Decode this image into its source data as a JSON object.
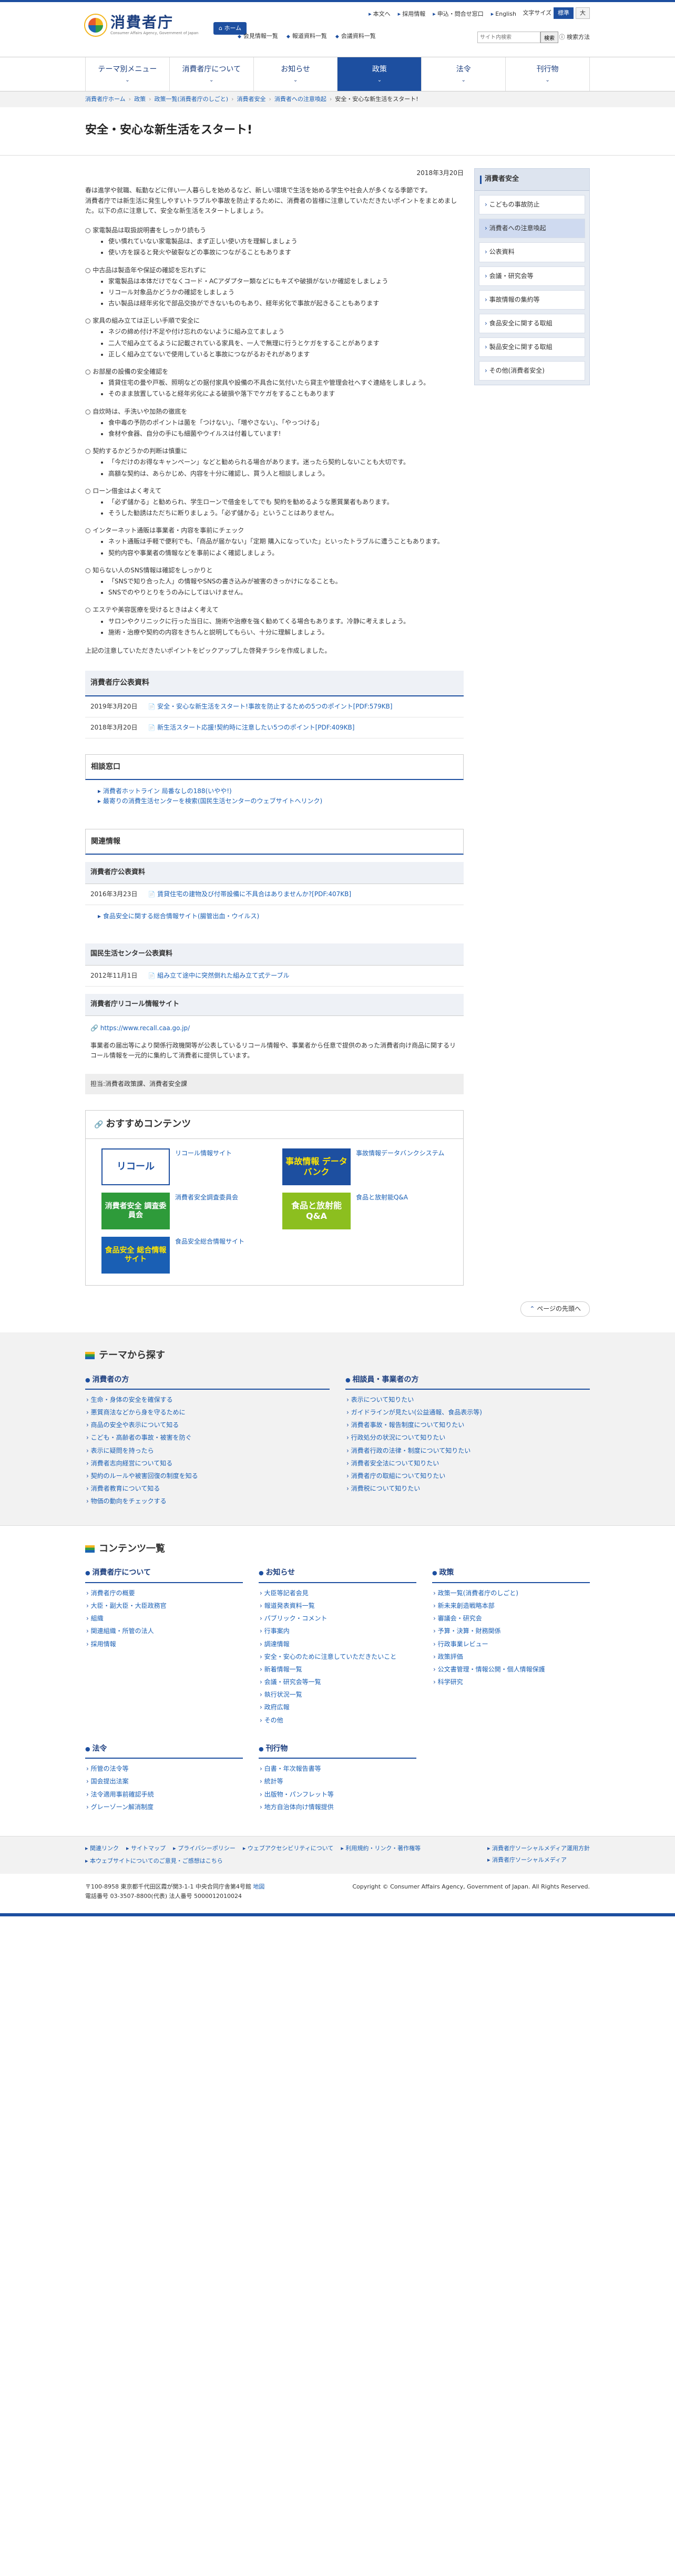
{
  "header": {
    "logo_text": "消費者庁",
    "logo_sub": "Consumer Affairs Agency, Government of Japan",
    "home_label": "ホーム",
    "util_links": [
      "本文へ",
      "採用情報",
      "申込・問合せ窓口",
      "English"
    ],
    "text_size_label": "文字サイズ",
    "text_size_options": [
      "標準",
      "大"
    ],
    "quick_links": [
      "会見情報一覧",
      "報道資料一覧",
      "会議資料一覧"
    ],
    "search_placeholder": "サイト内検索",
    "search_button": "検索",
    "search_detail": "検索方法"
  },
  "gnav": {
    "items": [
      "テーマ別メニュー",
      "消費者庁について",
      "お知らせ",
      "政策",
      "法令",
      "刊行物"
    ],
    "active_index": 3
  },
  "breadcrumb": [
    "消費者庁ホーム",
    "政策",
    "政策一覧(消費者庁のしごと)",
    "消費者安全",
    "消費者への注意喚起",
    "安全・安心な新生活をスタート!"
  ],
  "page": {
    "title": "安全・安心な新生活をスタート!",
    "date": "2018年3月20日",
    "intro": [
      "春は進学や就職、転勤などに伴い一人暮らしを始めるなど、新しい環境で生活を始める学生や社会人が多くなる季節です。",
      "消費者庁では新生活に発生しやすいトラブルや事故を防止するために、消費者の皆様に注意していただきたいポイントをまとめました。以下の点に注意して、安全な新生活をスタートしましょう。"
    ],
    "tips": [
      {
        "title": "家電製品は取扱説明書をしっかり読もう",
        "items": [
          "使い慣れていない家電製品は、まず正しい使い方を理解しましょう",
          "使い方を誤ると発火や破裂などの事故につながることもあります"
        ]
      },
      {
        "title": "中古品は製造年や保証の確認を忘れずに",
        "items": [
          "家電製品は本体だけでなくコード・ACアダプター類などにもキズや破損がないか確認をしましょう",
          "リコール対象品かどうかの確認をしましょう",
          "古い製品は経年劣化で部品交換ができないものもあり、経年劣化で事故が起きることもあります"
        ]
      },
      {
        "title": "家具の組み立ては正しい手順で安全に",
        "items": [
          "ネジの締め付け不足や付け忘れのないように組み立てましょう",
          "二人で組み立てるように記載されている家具を、一人で無理に行うとケガをすることがあります",
          "正しく組み立てないで使用していると事故につながるおそれがあります"
        ]
      },
      {
        "title": "お部屋の設備の安全確認を",
        "items": [
          "賃貸住宅の畳や戸板、照明などの据付家具や設備の不具合に気付いたら貸主や管理会社へすぐ連絡をしましょう。",
          "そのまま放置していると経年劣化による破損や落下でケガをすることもあります"
        ]
      },
      {
        "title": "自炊時は、手洗いや加熱の徹底を",
        "items": [
          "食中毒の予防のポイントは菌を「つけない」、「増やさない」、「やっつける」",
          "食材や食器、自分の手にも細菌やウイルスは付着しています!"
        ]
      },
      {
        "title": "契約するかどうかの判断は慎重に",
        "items": [
          "「今だけのお得なキャンペーン」などと勧められる場合があります。迷ったら契約しないことも大切です。",
          "高額な契約は、あらかじめ、内容を十分に確認し、買う人と相談しましょう。"
        ]
      },
      {
        "title": "ローン借金はよく考えて",
        "items": [
          "「必ず儲かる」と勧められ、学生ローンで借金をしてでも 契約を勧めるような悪質業者もあります。",
          "そうした勧誘はただちに断りましょう。「必ず儲かる」ということはありません。"
        ]
      },
      {
        "title": "インターネット通販は事業者・内容を事前にチェック",
        "items": [
          "ネット通販は手軽で便利でも、「商品が届かない」「定期 購入になっていた」といったトラブルに遭うこともあります。",
          "契約内容や事業者の情報などを事前によく確認しましょう。"
        ]
      },
      {
        "title": "知らない人のSNS情報は確認をしっかりと",
        "items": [
          "「SNSで知り合った人」の情報やSNSの書き込みが被害のきっかけになることも。",
          "SNSでのやりとりをうのみにしてはいけません。"
        ]
      },
      {
        "title": "エステや美容医療を受けるときはよく考えて",
        "items": [
          "サロンやクリニックに行った当日に、施術や治療を強く勧めてくる場合もあります。冷静に考えましょう。",
          "施術・治療や契約の内容をきちんと説明してもらい、十分に理解しましょう。"
        ]
      }
    ],
    "outro": "上記の注意していただきたいポイントをピックアップした啓発チラシを作成しました。"
  },
  "sections": {
    "caa_docs_title": "消費者庁公表資料",
    "caa_docs": [
      {
        "date": "2019年3月20日",
        "title": "安全・安心な新生活をスタート!事故を防止するための5つのポイント[PDF:579KB]"
      },
      {
        "date": "2018年3月20日",
        "title": "新生活スタート応援!契約時に注意したい5つのポイント[PDF:409KB]"
      }
    ],
    "consult_title": "相談窓口",
    "consult_links": [
      "消費者ホットライン 局番なしの188(いやや!)",
      "最寄りの消費生活センターを検索(国民生活センターのウェブサイトへリンク)"
    ],
    "related_title": "関連情報",
    "related_caa_title": "消費者庁公表資料",
    "related_caa_docs": [
      {
        "date": "2016年3月23日",
        "title": "賃貸住宅の建物及び付帯設備に不具合はありませんか?[PDF:407KB]"
      }
    ],
    "related_links": [
      "食品安全に関する総合情報サイト(腸管出血・ウイルス)"
    ],
    "ncac_title": "国民生活センター公表資料",
    "ncac_docs": [
      {
        "date": "2012年11月1日",
        "title": "組み立て途中に突然倒れた組み立て式テーブル"
      }
    ],
    "recall_title": "消費者庁リコール情報サイト",
    "recall_url": "https://www.recall.caa.go.jp/",
    "recall_desc": "事業者の届出等により関係行政機関等が公表しているリコール情報や、事業者から任意で提供のあった消費者向け商品に関するリコール情報を一元的に集約して消費者に提供しています。",
    "owner": "担当:消費者政策課、消費者安全課"
  },
  "recommend": {
    "title": "おすすめコンテンツ",
    "items": [
      {
        "banner": "リコール",
        "label": "リコール情報サイト"
      },
      {
        "banner": "事故情報 データバンク",
        "label": "事故情報データバンクシステム"
      },
      {
        "banner": "消費者安全 調査委員会",
        "label": "消費者安全調査委員会"
      },
      {
        "banner": "食品と放射能 Q&A",
        "label": "食品と放射能Q&A"
      },
      {
        "banner": "食品安全 総合情報サイト",
        "label": "食品安全総合情報サイト"
      }
    ]
  },
  "side": {
    "title": "消費者安全",
    "items": [
      "こどもの事故防止",
      "消費者への注意喚起",
      "公表資料",
      "会議・研究会等",
      "事故情報の集約等",
      "食品安全に関する取組",
      "製品安全に関する取組",
      "その他(消費者安全)"
    ],
    "current_index": 1
  },
  "pagetop": "ページの先頭へ",
  "themes": {
    "title": "テーマから探す",
    "cols": [
      {
        "head": "消費者の方",
        "items": [
          "生命・身体の安全を確保する",
          "悪質商法などから身を守るために",
          "商品の安全や表示について知る",
          "こども・高齢者の事故・被害を防ぐ",
          "表示に疑問を持ったら",
          "消費者志向経営について知る",
          "契約のルールや被害回復の制度を知る",
          "消費者教育について知る",
          "物価の動向をチェックする"
        ]
      },
      {
        "head": "相談員・事業者の方",
        "items": [
          "表示について知りたい",
          "ガイドラインが見たい(公益通報、食品表示等)",
          "消費者事故・報告制度について知りたい",
          "行政処分の状況について知りたい",
          "消費者行政の法律・制度について知りたい",
          "消費者安全法について知りたい",
          "消費者庁の取組について知りたい",
          "消費税について知りたい"
        ]
      }
    ]
  },
  "contents": {
    "title": "コンテンツ一覧",
    "cols": [
      {
        "head": "消費者庁について",
        "items": [
          "消費者庁の概要",
          "大臣・副大臣・大臣政務官",
          "組織",
          "関連組織・所管の法人",
          "採用情報"
        ]
      },
      {
        "head": "お知らせ",
        "items": [
          "大臣等記者会見",
          "報道発表資料一覧",
          "パブリック・コメント",
          "行事案内",
          "調達情報",
          "安全・安心のために注意していただきたいこと",
          "新着情報一覧",
          "会議・研究会等一覧",
          "執行状況一覧",
          "政府広報",
          "その他"
        ]
      },
      {
        "head": "政策",
        "items": [
          "政策一覧(消費者庁のしごと)",
          "新未来創造戦略本部",
          "審議会・研究会",
          "予算・決算・財務関係",
          "行政事業レビュー",
          "政策評価",
          "公文書管理・情報公開・個人情報保護",
          "科学研究"
        ]
      },
      {
        "head": "法令",
        "items": [
          "所管の法令等",
          "国会提出法案",
          "法令適用事前確認手続",
          "グレーゾーン解消制度"
        ]
      },
      {
        "head": "刊行物",
        "items": [
          "白書・年次報告書等",
          "統計等",
          "出版物・パンフレット等",
          "地方自治体向け情報提供"
        ]
      }
    ]
  },
  "footer": {
    "links": [
      "関連リンク",
      "サイトマップ",
      "プライバシーポリシー",
      "ウェブアクセシビリティについて",
      "利用規約・リンク・著作権等",
      "本ウェブサイトについてのご意見・ご感想はこちら"
    ],
    "social": [
      "消費者庁ソーシャルメディア運用方針",
      "消費者庁ソーシャルメディア"
    ],
    "address": "〒100-8958 東京都千代田区霞が関3-1-1 中央合同庁舎第4号館",
    "map": "地図",
    "phone": "電話番号 03-3507-8800(代表) 法人番号 5000012010024",
    "copyright": "Copyright © Consumer Affairs Agency, Government of Japan. All Rights Reserved."
  }
}
